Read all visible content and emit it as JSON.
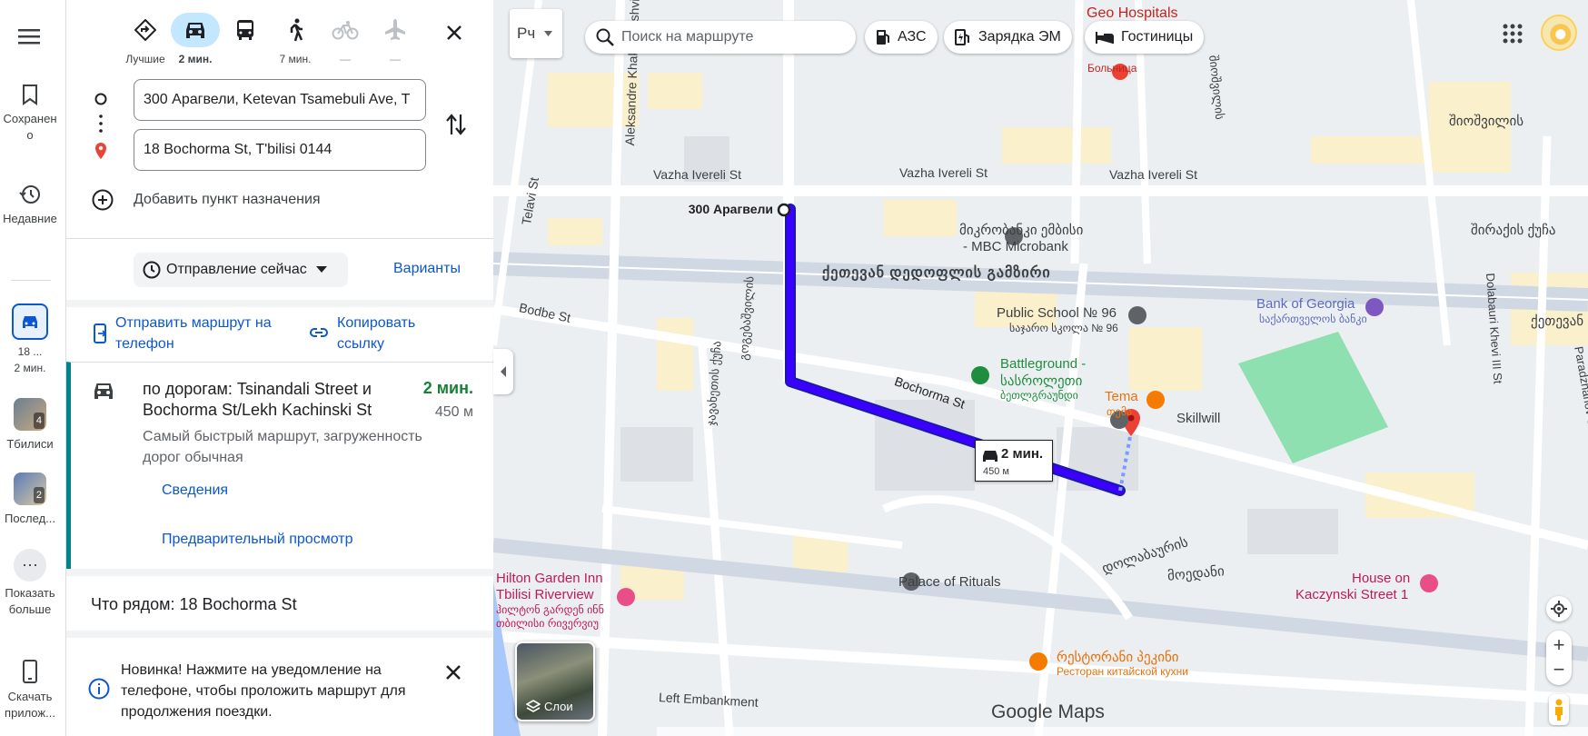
{
  "rail": {
    "saved": "Сохранено",
    "recent": "Недавние",
    "recent_route_label": "18 ...",
    "recent_route_time": "2 мин.",
    "tbilisi": "Тбилиси",
    "tbilisi_count": "4",
    "last": "Послед...",
    "last_count": "2",
    "show_more": "Показать больше",
    "download": "Скачать прилож..."
  },
  "modes": [
    {
      "name": "Лучшие",
      "label": "Лучшие"
    },
    {
      "name": "car",
      "label": "2 мин."
    },
    {
      "name": "transit",
      "label": ""
    },
    {
      "name": "walk",
      "label": "7 мин."
    },
    {
      "name": "bike",
      "label": "—"
    },
    {
      "name": "flight",
      "label": "—"
    }
  ],
  "inputs": {
    "origin": "300 Арагвели, Ketevan Tsamebuli Ave, T",
    "destination": "18 Bochorma St, T'bilisi 0144",
    "add_destination": "Добавить пункт назначения"
  },
  "departure": {
    "label": "Отправление сейчас",
    "options": "Варианты"
  },
  "share": {
    "send_to_phone": "Отправить маршрут на телефон",
    "copy_link": "Копировать ссылку"
  },
  "route": {
    "title": "по дорогам: Tsinandali Street и Bochorma St/Lekh Kachinski St",
    "time": "2 мин.",
    "distance": "450 м",
    "description": "Самый быстрый маршрут, загруженность дорог обычная",
    "details": "Сведения",
    "preview": "Предварительный просмотр"
  },
  "nearby": "Что рядом: 18 Bochorma St",
  "notice": "Новинка! Нажмите на уведомление на телефоне, чтобы проложить маршрут для продолжения поездки.",
  "map": {
    "lang_button": "Рч",
    "search_placeholder": "Поиск на маршруте",
    "chips": [
      "АЗС",
      "Зарядка ЭМ",
      "Гостиницы"
    ],
    "layers": "Слои",
    "route_box_time": "2 мин.",
    "route_box_dist": "450 м",
    "origin_label": "300 Арагвели",
    "footer": "Google Maps",
    "labels": [
      "Geo Hospitals",
      "Больница",
      "Vazha Ivereli St",
      "Vazha Ivereli St",
      "Vazha Ivereli St",
      "მიკრობანკი ემბისი",
      "- MBC Microbank",
      "ქეთევან დედოფლის გამზირი",
      "Public School № 96",
      "საჯარო სკოლა № 96",
      "Bank of Georgia",
      "საქართველოს ბანკი",
      "Battleground -",
      "სასროლეთი",
      "ბეთლგრაუნდი",
      "Tema",
      "თემა",
      "Skillwill",
      "Bochorma St",
      "Bodbe St",
      "Telavi St",
      "Aleksandre Khakhanashvili St",
      "Palace of Rituals",
      "Hilton Garden Inn",
      "Tbilisi Riverview",
      "ჰილტონ გარდენ ინნ",
      "თბილისი რივერვიუ",
      "House on",
      "Kaczynski Street 1",
      "რესტორანი პეკინი",
      "Ресторан китайской кухни",
      "Left Embankment",
      "Dolabauri Khevi III St",
      "Paradzhanov St",
      "მოედანი",
      "დოლაბაურის",
      "შიოშვილის",
      "შირაქის ქუჩა",
      "ქეთევან",
      "შიოშვილის",
      "გოგებაშვილის",
      "ჯავახეთის ქუჩა"
    ],
    "colors": {
      "route": "#3a00ff",
      "park": "#8fe0b0",
      "road": "#ffffff",
      "block": "#fbf1cc"
    }
  }
}
